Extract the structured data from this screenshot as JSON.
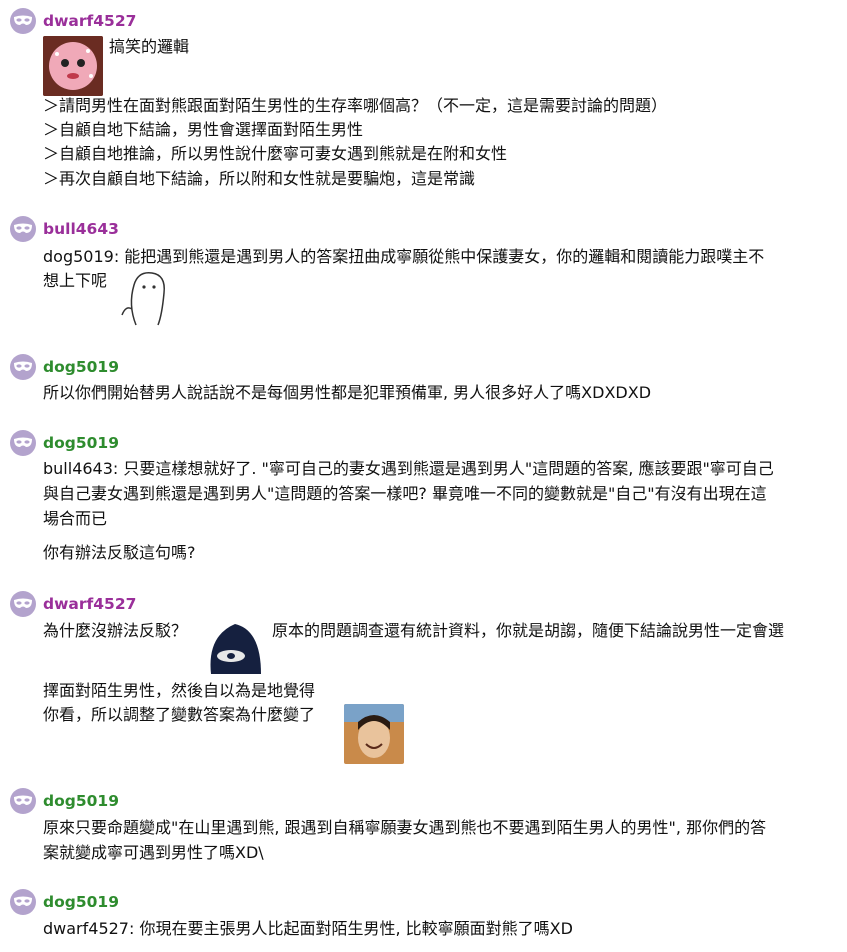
{
  "comments": [
    {
      "user": "dwarf4527",
      "lines": [
        "搞笑的邏輯",
        "＞請問男性在面對熊跟面對陌生男性的生存率哪個高？（不一定，這是需要討論的問題）",
        "＞自顧自地下結論，男性會選擇面對陌生男性",
        "＞自顧自地推論，所以男性說什麼寧可妻女遇到熊就是在附和女性",
        "＞再次自顧自地下結論，所以附和女性就是要騙炮，這是常識"
      ]
    },
    {
      "user": "bull4643",
      "lines": [
        "dog5019: 能把遇到熊還是遇到男人的答案扭曲成寧願從熊中保護妻女，你的邏輯和閱讀能力跟噗主不",
        "想上下呢"
      ]
    },
    {
      "user": "dog5019",
      "lines": [
        "所以你們開始替男人說話說不是每個男性都是犯罪預備軍, 男人很多好人了嗎XDXDXD"
      ]
    },
    {
      "user": "dog5019",
      "lines": [
        "bull4643: 只要這樣想就好了. \"寧可自己的妻女遇到熊還是遇到男人\"這問題的答案, 應該要跟\"寧可自己",
        "與自己妻女遇到熊還是遇到男人\"這問題的答案一樣吧? 畢竟唯一不同的變數就是\"自己\"有沒有出現在這",
        "場合而已",
        "你有辦法反駁這句嗎?"
      ]
    },
    {
      "user": "dwarf4527",
      "lines": [
        "為什麼沒辦法反駁？",
        "原本的問題調查還有統計資料，你就是胡謅，隨便下結論說男性一定會選",
        "擇面對陌生男性，然後自以為是地覺得",
        "你看，所以調整了變數答案為什麼變了"
      ]
    },
    {
      "user": "dog5019",
      "lines": [
        "原來只要命題變成\"在山里遇到熊, 跟遇到自稱寧願妻女遇到熊也不要遇到陌生男人的男性\", 那你們的答",
        "案就變成寧可遇到男性了嗎XD\\"
      ]
    },
    {
      "user": "dog5019",
      "lines": [
        "dwarf4527: 你現在要主張男人比起面對陌生男性, 比較寧願面對熊了嗎XD"
      ]
    }
  ]
}
